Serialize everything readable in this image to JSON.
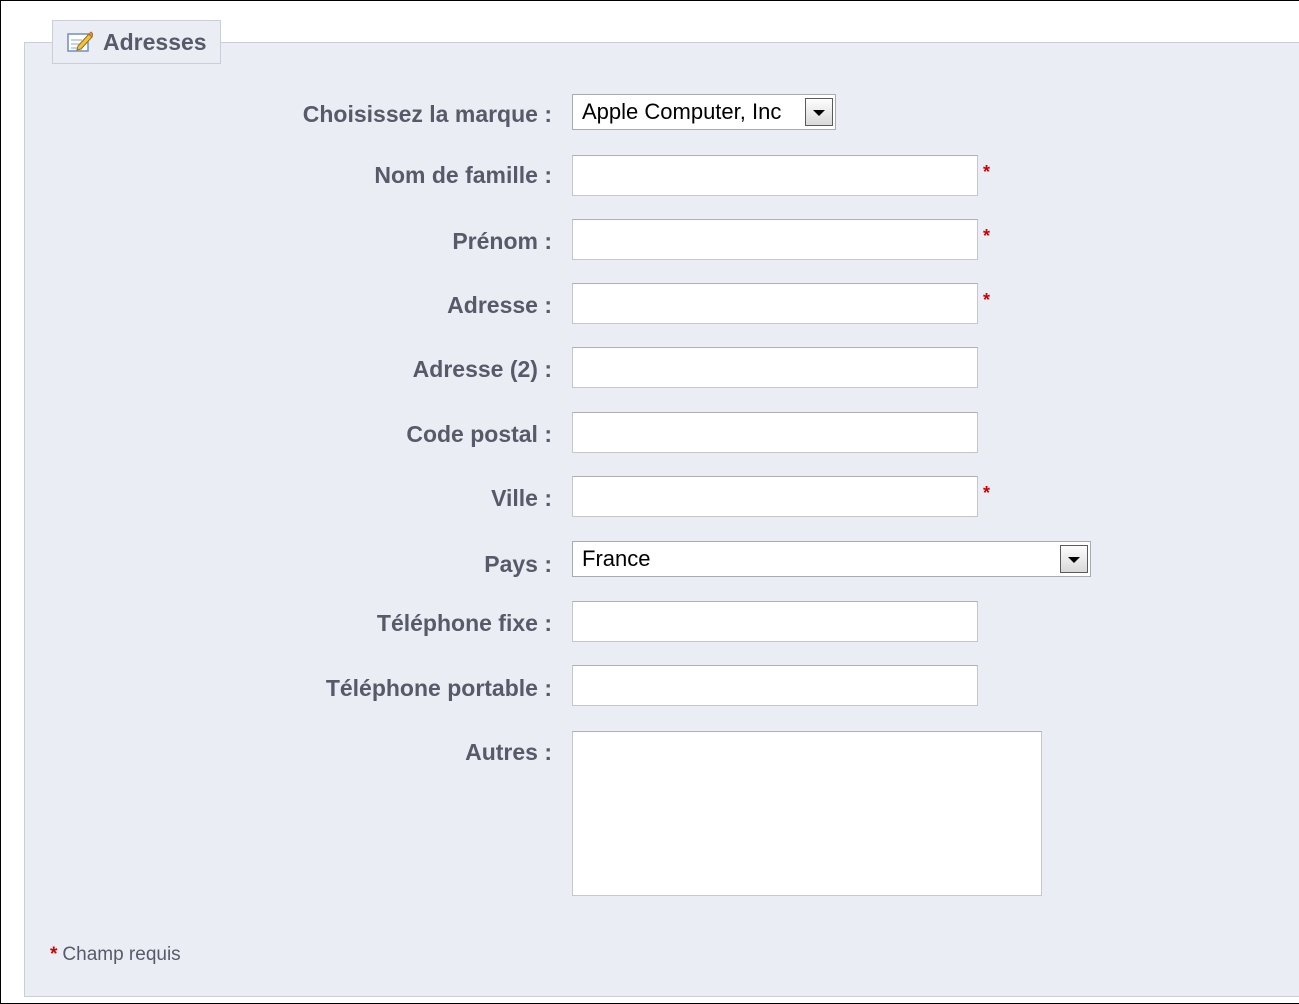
{
  "section": {
    "title": "Adresses",
    "icon": "edit-note-icon"
  },
  "fields": {
    "brand": {
      "label": "Choisissez la marque :",
      "value": "Apple Computer, Inc"
    },
    "lastname": {
      "label": "Nom de famille :",
      "value": "",
      "required": true
    },
    "firstname": {
      "label": "Prénom :",
      "value": "",
      "required": true
    },
    "address1": {
      "label": "Adresse :",
      "value": "",
      "required": true
    },
    "address2": {
      "label": "Adresse (2) :",
      "value": ""
    },
    "postcode": {
      "label": "Code postal :",
      "value": ""
    },
    "city": {
      "label": "Ville :",
      "value": "",
      "required": true
    },
    "country": {
      "label": "Pays :",
      "value": "France"
    },
    "phone": {
      "label": "Téléphone fixe :",
      "value": ""
    },
    "mobile": {
      "label": "Téléphone portable :",
      "value": ""
    },
    "other": {
      "label": "Autres :",
      "value": ""
    }
  },
  "required_marker": "*",
  "footnote": "Champ requis",
  "colors": {
    "panel_bg": "#ebedf4",
    "panel_border": "#ccced7",
    "label_text": "#585a69",
    "required_star": "#cc0000"
  }
}
